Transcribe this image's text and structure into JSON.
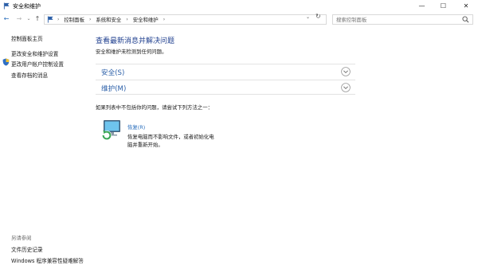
{
  "window": {
    "title": "安全和维护"
  },
  "nav": {
    "breadcrumbs": [
      "控制面板",
      "系统和安全",
      "安全和维护"
    ],
    "search_placeholder": "搜索控制面板"
  },
  "sidebar": {
    "items": [
      {
        "label": "控制面板主页"
      },
      {
        "label": "更改安全和维护设置"
      },
      {
        "label": "更改用户帐户控制设置"
      },
      {
        "label": "查看存档的消息"
      }
    ],
    "see_also_label": "另请参阅",
    "see_also": [
      {
        "label": "文件历史记录"
      },
      {
        "label": "Windows 程序兼容性疑难解答"
      }
    ]
  },
  "main": {
    "heading": "查看最新消息并解决问题",
    "subtext": "安全和维护未检测到任何问题。",
    "sections": [
      {
        "label": "安全(S)"
      },
      {
        "label": "维护(M)"
      }
    ],
    "hint": "如果列表中不包括你的问题，请尝试下列方法之一：",
    "recovery": {
      "link": "恢复(R)",
      "description": "恢复电脑而不影响文件，或者初始化电脑并重新开始。"
    }
  },
  "colors": {
    "link_blue": "#2b6fbd",
    "heading_blue": "#1f3f8f",
    "section_blue": "#2b5fa8"
  },
  "icons": [
    "app-flag-icon",
    "minimize-icon",
    "maximize-icon",
    "close-icon",
    "back-arrow-icon",
    "forward-arrow-icon",
    "history-dropdown-icon",
    "up-arrow-icon",
    "flag-icon",
    "address-dropdown-icon",
    "refresh-icon",
    "search-icon",
    "uac-shield-icon",
    "chevron-down-icon",
    "recovery-icon"
  ]
}
